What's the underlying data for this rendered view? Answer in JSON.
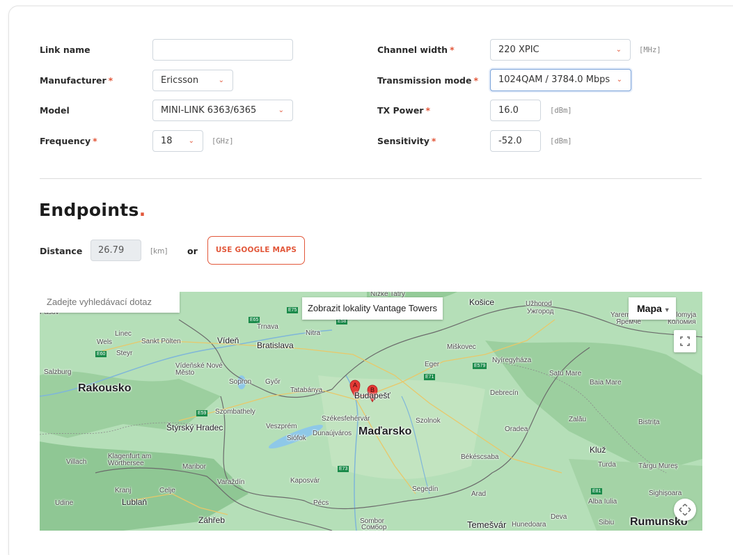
{
  "form": {
    "link_name": {
      "label": "Link name",
      "value": ""
    },
    "manufacturer": {
      "label": "Manufacturer",
      "value": "Ericsson"
    },
    "model": {
      "label": "Model",
      "value": "MINI-LINK 6363/6365"
    },
    "frequency": {
      "label": "Frequency",
      "value": "18",
      "unit": "[GHz]"
    },
    "channel_width": {
      "label": "Channel width",
      "value": "220 XPIC",
      "unit": "[MHz]"
    },
    "transmission_mode": {
      "label": "Transmission mode",
      "value": "1024QAM / 3784.0 Mbps"
    },
    "tx_power": {
      "label": "TX Power",
      "value": "16.0",
      "unit": "[dBm]"
    },
    "sensitivity": {
      "label": "Sensitivity",
      "value": "-52.0",
      "unit": "[dBm]"
    },
    "required_mark": "*"
  },
  "endpoints": {
    "title": "Endpoints",
    "title_dot": ".",
    "distance_label": "Distance",
    "distance_value": "26.79",
    "distance_unit": "[km]",
    "or_text": "or",
    "google_maps_button": "USE GOOGLE MAPS"
  },
  "map": {
    "search_placeholder": "Zadejte vyhledávací dotaz",
    "toggle_label": "Zobrazit lokality Vantage Towers",
    "type_label": "Mapa",
    "markers": [
      "A",
      "B"
    ],
    "countries": [
      "Rakousko",
      "Maďarsko",
      "Rumunsko"
    ],
    "cities_major": [
      "Vídeň",
      "Bratislava",
      "Budapešť",
      "Košice",
      "Štýrský Hradec",
      "Lublaň",
      "Záhřeb",
      "Kluž"
    ],
    "places": [
      "Linec",
      "Wels",
      "Steyr",
      "Sankt Pölten",
      "Salzburg",
      "Trnava",
      "Nitra",
      "Miškovec",
      "Eger",
      "Nyíregyháza",
      "Užhorod",
      "Ужгород",
      "Satu Mare",
      "Baia Mare",
      "Vídeňské Nové Město",
      "Sopron",
      "Győr",
      "Tatabánya",
      "Debrecín",
      "Szombathely",
      "Székesfehérvár",
      "Szolnok",
      "Zalău",
      "Bistrița",
      "Veszprém",
      "Siófok",
      "Dunaújváros",
      "Oradea",
      "Villach",
      "Klagenfurt am Wörthersee",
      "Maribor",
      "Békéscsaba",
      "Turda",
      "Târgu Mureș",
      "Varaždín",
      "Kaposvár",
      "Kranj",
      "Celje",
      "Segedín",
      "Arad",
      "Alba Iulia",
      "Sighișoara",
      "Udine",
      "Pécs",
      "Sombor",
      "Сомбор",
      "Temešvár",
      "Hunedoara",
      "Deva",
      "Sibiu",
      "Yaremche",
      "Яремче",
      "Kolomyja",
      "Коломия",
      "Pasov",
      "Nízke Tatry"
    ],
    "roads": [
      "E65",
      "E75",
      "E58",
      "E60",
      "E579",
      "E71",
      "E59",
      "E73",
      "E81"
    ]
  }
}
